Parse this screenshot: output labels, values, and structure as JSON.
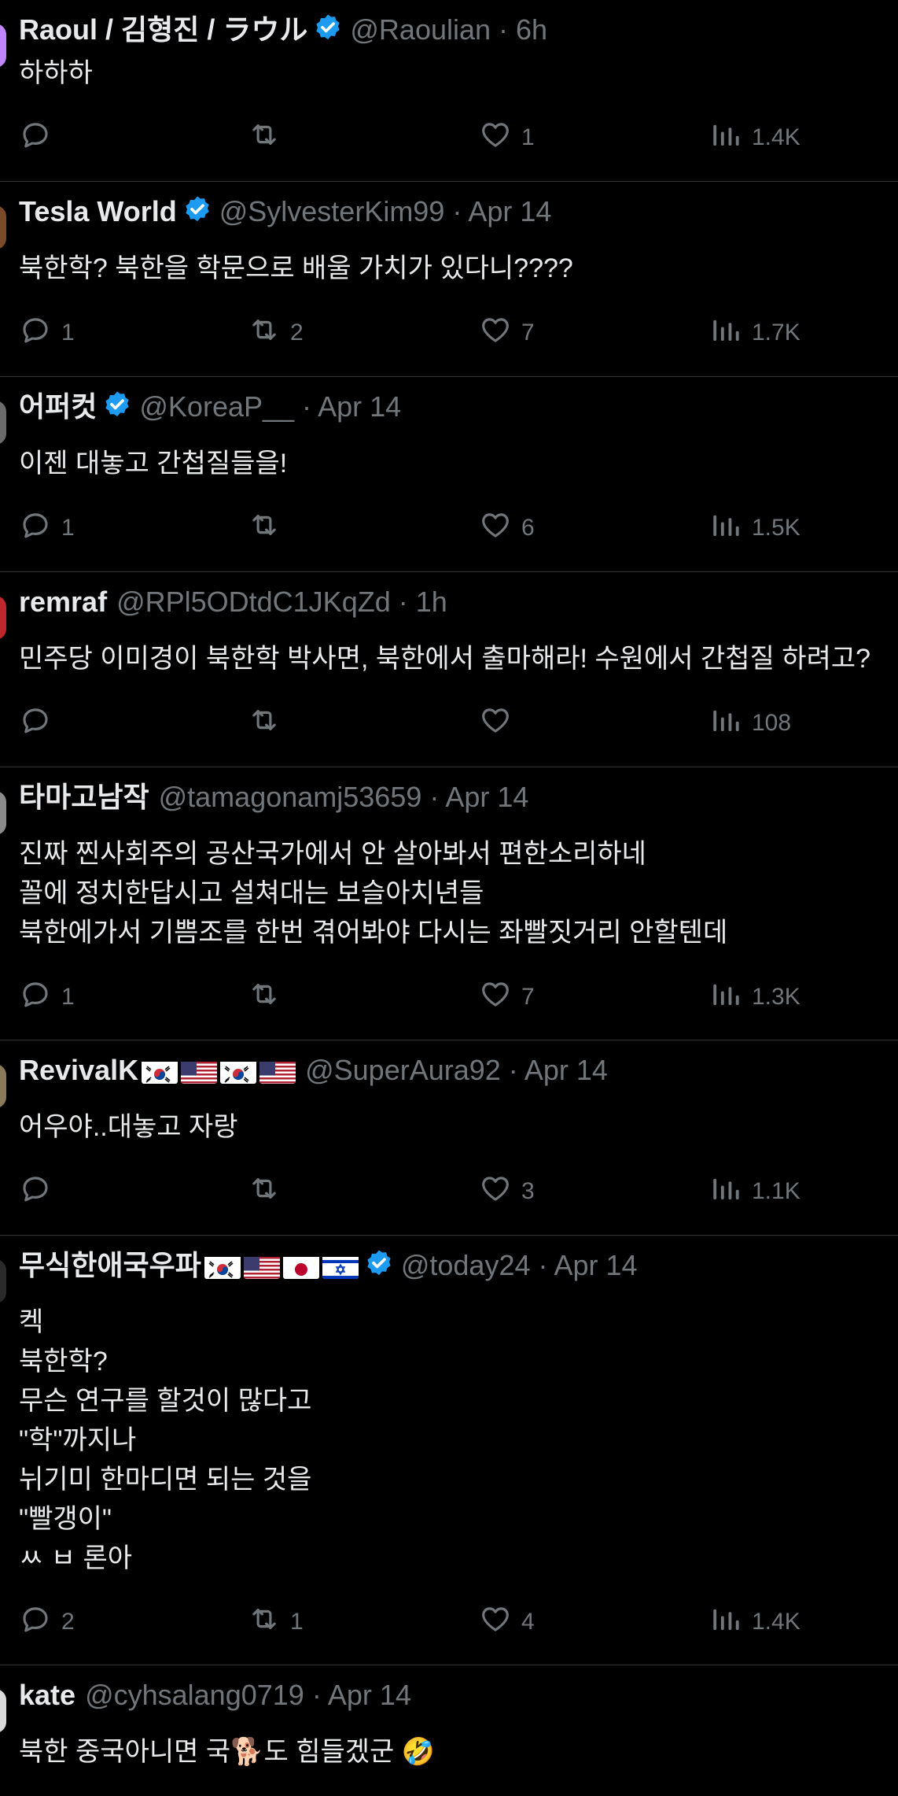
{
  "tweets": [
    {
      "name": "Raoul / 김형진 / ラウル",
      "verified": true,
      "flags": [],
      "handle": "@Raoulian",
      "time": "6h",
      "text": "하하하",
      "replies": "",
      "retweets": "",
      "likes": "1",
      "views": "1.4K"
    },
    {
      "name": "Tesla World",
      "verified": true,
      "flags": [],
      "handle": "@SylvesterKim99",
      "time": "Apr 14",
      "text": "북한학? 북한을 학문으로 배울 가치가 있다니????",
      "replies": "1",
      "retweets": "2",
      "likes": "7",
      "views": "1.7K"
    },
    {
      "name": "어퍼컷",
      "verified": true,
      "flags": [],
      "handle": "@KoreaP__",
      "time": "Apr 14",
      "text": "이젠 대놓고 간첩질들을!",
      "replies": "1",
      "retweets": "",
      "likes": "6",
      "views": "1.5K"
    },
    {
      "name": "remraf",
      "verified": false,
      "flags": [],
      "handle": "@RPl5ODtdC1JKqZd",
      "time": "1h",
      "text": "민주당 이미경이 북한학 박사면, 북한에서 출마해라! 수원에서 간첩질 하려고?",
      "replies": "",
      "retweets": "",
      "likes": "",
      "views": "108"
    },
    {
      "name": "타마고남작",
      "verified": false,
      "flags": [],
      "handle": "@tamagonamj53659",
      "time": "Apr 14",
      "text": "진짜 찐사회주의 공산국가에서 안 살아봐서 편한소리하네\n꼴에 정치한답시고 설쳐대는 보슬아치년들\n북한에가서 기쁨조를 한번 겪어봐야 다시는 좌빨짓거리 안할텐데",
      "replies": "1",
      "retweets": "",
      "likes": "7",
      "views": "1.3K"
    },
    {
      "name": "RevivalK",
      "verified": false,
      "flags": [
        "kr",
        "us",
        "kr",
        "us"
      ],
      "handle": "@SuperAura92",
      "time": "Apr 14",
      "text": "어우야..대놓고 자랑",
      "replies": "",
      "retweets": "",
      "likes": "3",
      "views": "1.1K"
    },
    {
      "name": "무식한애국우파",
      "verified": true,
      "flags": [
        "kr",
        "us",
        "jp",
        "il"
      ],
      "handle": "@today24",
      "time": "Apr 14",
      "text": "켁\n북한학?\n무슨 연구를 할것이 많다고\n\"학\"까지나\n뉘기미 한마디면 되는 것을\n\"빨갱이\"\nㅆ ㅂ 론아",
      "replies": "2",
      "retweets": "1",
      "likes": "4",
      "views": "1.4K"
    },
    {
      "name": "kate",
      "verified": false,
      "flags": [],
      "handle": "@cyhsalang0719",
      "time": "Apr 14",
      "text": "북한 중국아니면 국🐕도 힘들겠군 🤣",
      "replies": "",
      "retweets": "",
      "likes": "",
      "views": ""
    }
  ],
  "colors": {
    "background": "#000000",
    "text": "#e7e9ea",
    "muted": "#71767b",
    "divider": "#2f3336",
    "verified": "#1d9bf0"
  },
  "icons": {
    "reply": "speech-bubble-icon",
    "retweet": "retweet-arrows-icon",
    "like": "heart-icon",
    "views": "bar-chart-icon",
    "verified": "verified-badge-icon"
  }
}
